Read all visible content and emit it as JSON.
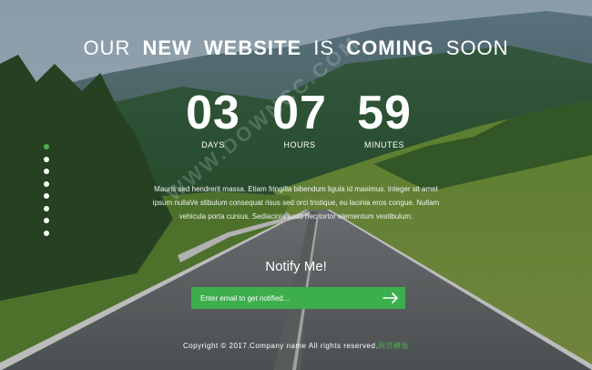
{
  "headline": {
    "part1": "OUR",
    "part2": "NEW",
    "part3": "WEBSITE",
    "part4": "IS",
    "part5": "COMING",
    "part6": "SOON"
  },
  "countdown": [
    {
      "value": "03",
      "label": "DAYS"
    },
    {
      "value": "07",
      "label": "HOURS"
    },
    {
      "value": "59",
      "label": "MINUTES"
    }
  ],
  "slider_dots": {
    "count": 8,
    "active_index": 0
  },
  "description": "Mauris sed hendrerit massa. Etiam fringilla bibendum ligula id maximus. Integer sit amet ipsum nullaVe stibulum consequat risus sed orci tristique, eu lacinia eros congue. Nullam vehicula porta cursus. Sediacinia justo nec tortor elementum vestibulum.",
  "notify": {
    "title": "Notify Me!",
    "placeholder": "Enter email to get notified...",
    "submit_icon": "arrow-right-icon"
  },
  "footer": {
    "text": "Copyright © 2017.Company name All rights reserved.",
    "link": "网页模板"
  },
  "watermark": "WWW.DOWNCC.COM",
  "colors": {
    "accent": "#3dae4c",
    "active_dot": "#4cae4c",
    "text": "#ffffff"
  }
}
